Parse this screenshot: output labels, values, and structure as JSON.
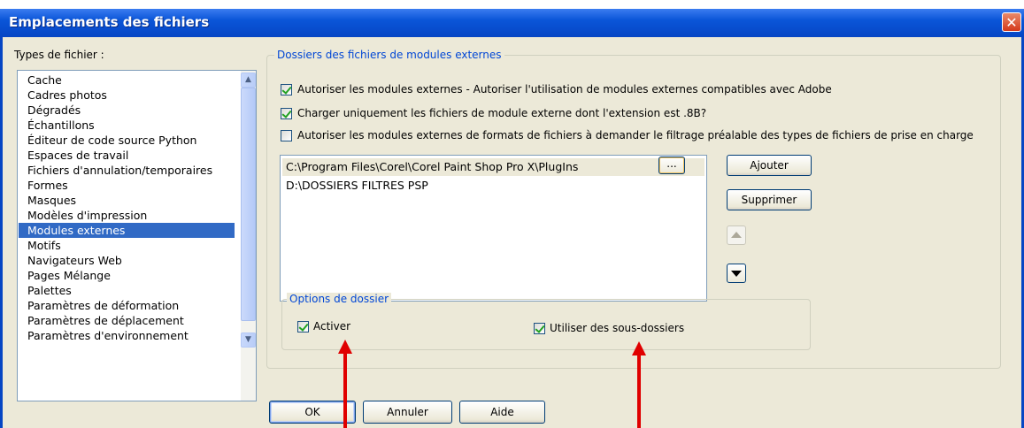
{
  "window": {
    "title": "Emplacements des fichiers",
    "close_glyph": "✕"
  },
  "file_types": {
    "label": "Types de fichier :",
    "items": [
      "Cache",
      "Cadres photos",
      "Dégradés",
      "Échantillons",
      "Éditeur de code source Python",
      "Espaces de travail",
      "Fichiers d'annulation/temporaires",
      "Formes",
      "Masques",
      "Modèles d'impression",
      "Modules externes",
      "Motifs",
      "Navigateurs Web",
      "Pages Mélange",
      "Palettes",
      "Paramètres de déformation",
      "Paramètres de déplacement",
      "Paramètres d'environnement"
    ],
    "selected": "Modules externes"
  },
  "plugins_group": {
    "legend": "Dossiers des fichiers de modules externes",
    "options": [
      {
        "label": "Autoriser les modules externes - Autoriser l'utilisation de modules externes compatibles avec Adobe",
        "checked": true
      },
      {
        "label": "Charger uniquement les fichiers de module externe dont l'extension est .8B?",
        "checked": true
      },
      {
        "label": "Autoriser les modules externes de formats de fichiers à demander le filtrage préalable des types de fichiers de prise en charge",
        "checked": false
      }
    ],
    "paths": [
      "C:\\Program Files\\Corel\\Corel Paint Shop Pro X\\PlugIns",
      "D:\\DOSSIERS FILTRES PSP"
    ],
    "browse_label": "...",
    "add_label": "Ajouter",
    "remove_label": "Supprimer"
  },
  "folder_options": {
    "legend": "Options de dossier",
    "enable": {
      "label": "Activer",
      "checked": true
    },
    "subfolders": {
      "label": "Utiliser des sous-dossiers",
      "checked": true
    }
  },
  "footer": {
    "ok": "OK",
    "cancel": "Annuler",
    "help": "Aide"
  },
  "colors": {
    "title_bar": "#0a55d8",
    "selection": "#316ac5",
    "legend_text": "#0046d5",
    "annotation_arrow": "#e00000",
    "dialog_bg": "#ece9d8"
  }
}
